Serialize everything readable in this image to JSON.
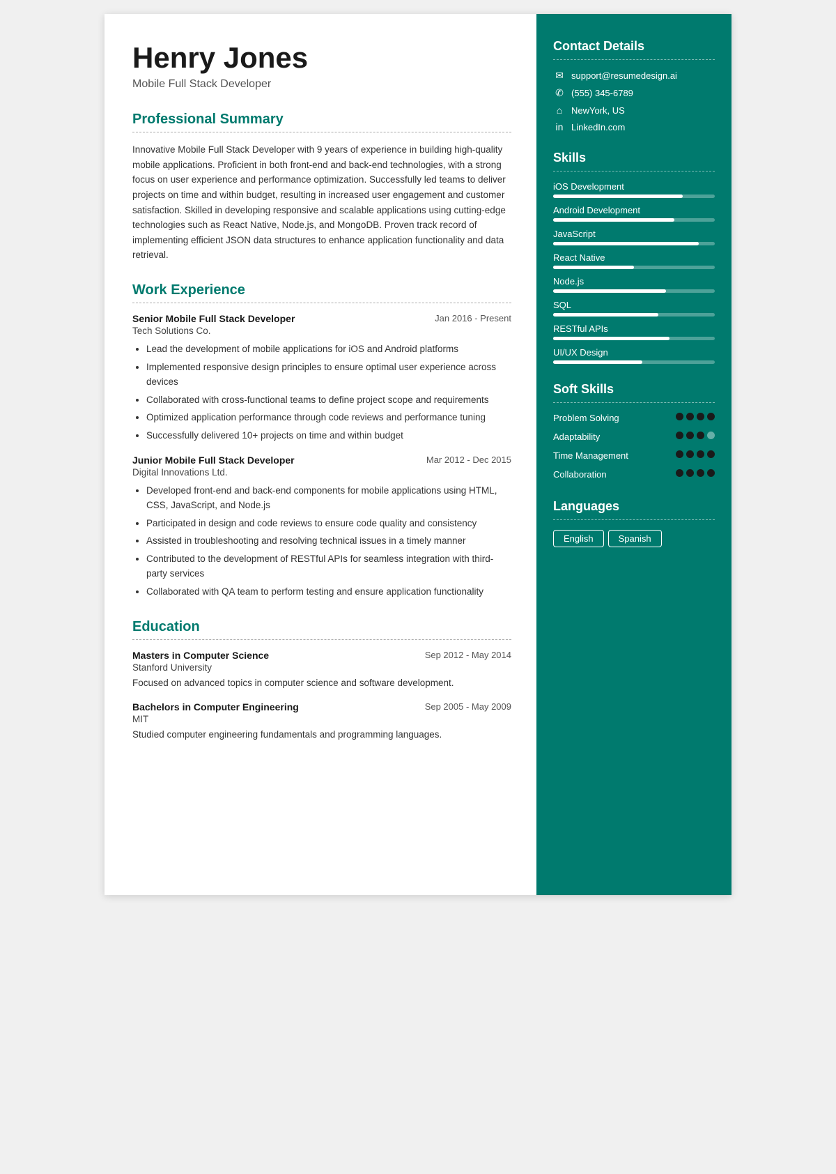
{
  "header": {
    "name": "Henry Jones",
    "job_title": "Mobile Full Stack Developer"
  },
  "summary": {
    "section_title": "Professional Summary",
    "text": "Innovative Mobile Full Stack Developer with 9 years of experience in building high-quality mobile applications. Proficient in both front-end and back-end technologies, with a strong focus on user experience and performance optimization. Successfully led teams to deliver projects on time and within budget, resulting in increased user engagement and customer satisfaction. Skilled in developing responsive and scalable applications using cutting-edge technologies such as React Native, Node.js, and MongoDB. Proven track record of implementing efficient JSON data structures to enhance application functionality and data retrieval."
  },
  "work_experience": {
    "section_title": "Work Experience",
    "jobs": [
      {
        "title": "Senior Mobile Full Stack Developer",
        "date": "Jan 2016 - Present",
        "company": "Tech Solutions Co.",
        "bullets": [
          "Lead the development of mobile applications for iOS and Android platforms",
          "Implemented responsive design principles to ensure optimal user experience across devices",
          "Collaborated with cross-functional teams to define project scope and requirements",
          "Optimized application performance through code reviews and performance tuning",
          "Successfully delivered 10+ projects on time and within budget"
        ]
      },
      {
        "title": "Junior Mobile Full Stack Developer",
        "date": "Mar 2012 - Dec 2015",
        "company": "Digital Innovations Ltd.",
        "bullets": [
          "Developed front-end and back-end components for mobile applications using HTML, CSS, JavaScript, and Node.js",
          "Participated in design and code reviews to ensure code quality and consistency",
          "Assisted in troubleshooting and resolving technical issues in a timely manner",
          "Contributed to the development of RESTful APIs for seamless integration with third-party services",
          "Collaborated with QA team to perform testing and ensure application functionality"
        ]
      }
    ]
  },
  "education": {
    "section_title": "Education",
    "degrees": [
      {
        "degree": "Masters in Computer Science",
        "date": "Sep 2012 - May 2014",
        "institution": "Stanford University",
        "description": "Focused on advanced topics in computer science and software development."
      },
      {
        "degree": "Bachelors in Computer Engineering",
        "date": "Sep 2005 - May 2009",
        "institution": "MIT",
        "description": "Studied computer engineering fundamentals and programming languages."
      }
    ]
  },
  "contact": {
    "section_title": "Contact Details",
    "items": [
      {
        "icon": "✉",
        "text": "support@resumedesign.ai"
      },
      {
        "icon": "✆",
        "text": "(555) 345-6789"
      },
      {
        "icon": "⌂",
        "text": "NewYork, US"
      },
      {
        "icon": "in",
        "text": "LinkedIn.com"
      }
    ]
  },
  "skills": {
    "section_title": "Skills",
    "items": [
      {
        "name": "iOS Development",
        "level": 80
      },
      {
        "name": "Android Development",
        "level": 75
      },
      {
        "name": "JavaScript",
        "level": 90
      },
      {
        "name": "React Native",
        "level": 50
      },
      {
        "name": "Node.js",
        "level": 70
      },
      {
        "name": "SQL",
        "level": 65
      },
      {
        "name": "RESTful APIs",
        "level": 72
      },
      {
        "name": "UI/UX Design",
        "level": 55
      }
    ]
  },
  "soft_skills": {
    "section_title": "Soft Skills",
    "items": [
      {
        "name": "Problem Solving",
        "filled": 4,
        "empty": 0
      },
      {
        "name": "Adaptability",
        "filled": 3,
        "empty": 1
      },
      {
        "name": "Time Management",
        "filled": 4,
        "empty": 0
      },
      {
        "name": "Collaboration",
        "filled": 4,
        "empty": 0
      }
    ]
  },
  "languages": {
    "section_title": "Languages",
    "items": [
      "English",
      "Spanish"
    ]
  }
}
